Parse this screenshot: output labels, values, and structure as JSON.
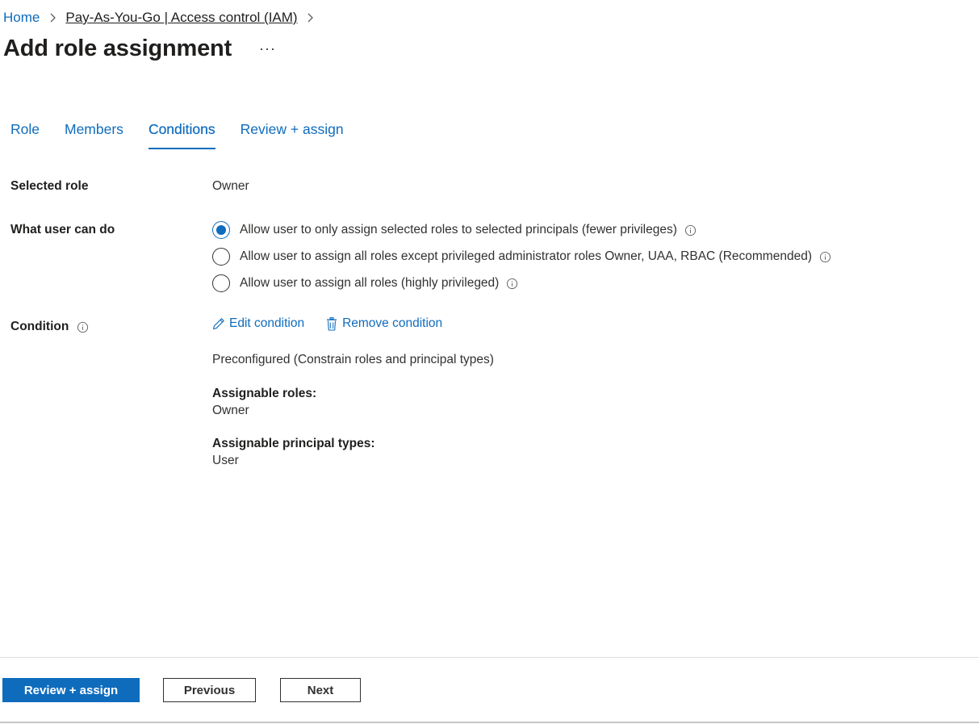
{
  "breadcrumb": {
    "home": "Home",
    "parent": "Pay-As-You-Go | Access control (IAM)"
  },
  "page": {
    "title": "Add role assignment",
    "more": "···"
  },
  "tabs": [
    {
      "label": "Role",
      "active": false
    },
    {
      "label": "Members",
      "active": false
    },
    {
      "label": "Conditions",
      "active": true
    },
    {
      "label": "Review + assign",
      "active": false
    }
  ],
  "selected_role": {
    "label": "Selected role",
    "value": "Owner"
  },
  "what_user_can_do": {
    "label": "What user can do",
    "options": [
      {
        "label": "Allow user to only assign selected roles to selected principals (fewer privileges)",
        "checked": true
      },
      {
        "label": "Allow user to assign all roles except privileged administrator roles Owner, UAA, RBAC (Recommended)",
        "checked": false
      },
      {
        "label": "Allow user to assign all roles (highly privileged)",
        "checked": false
      }
    ]
  },
  "condition": {
    "label": "Condition",
    "edit_label": "Edit condition",
    "remove_label": "Remove condition",
    "description": "Preconfigured (Constrain roles and principal types)",
    "assignable_roles_label": "Assignable roles:",
    "assignable_roles_value": "Owner",
    "assignable_principal_types_label": "Assignable principal types:",
    "assignable_principal_types_value": "User"
  },
  "footer": {
    "review_assign": "Review + assign",
    "previous": "Previous",
    "next": "Next"
  },
  "colors": {
    "accent": "#0f6cbd",
    "text": "#323130"
  }
}
